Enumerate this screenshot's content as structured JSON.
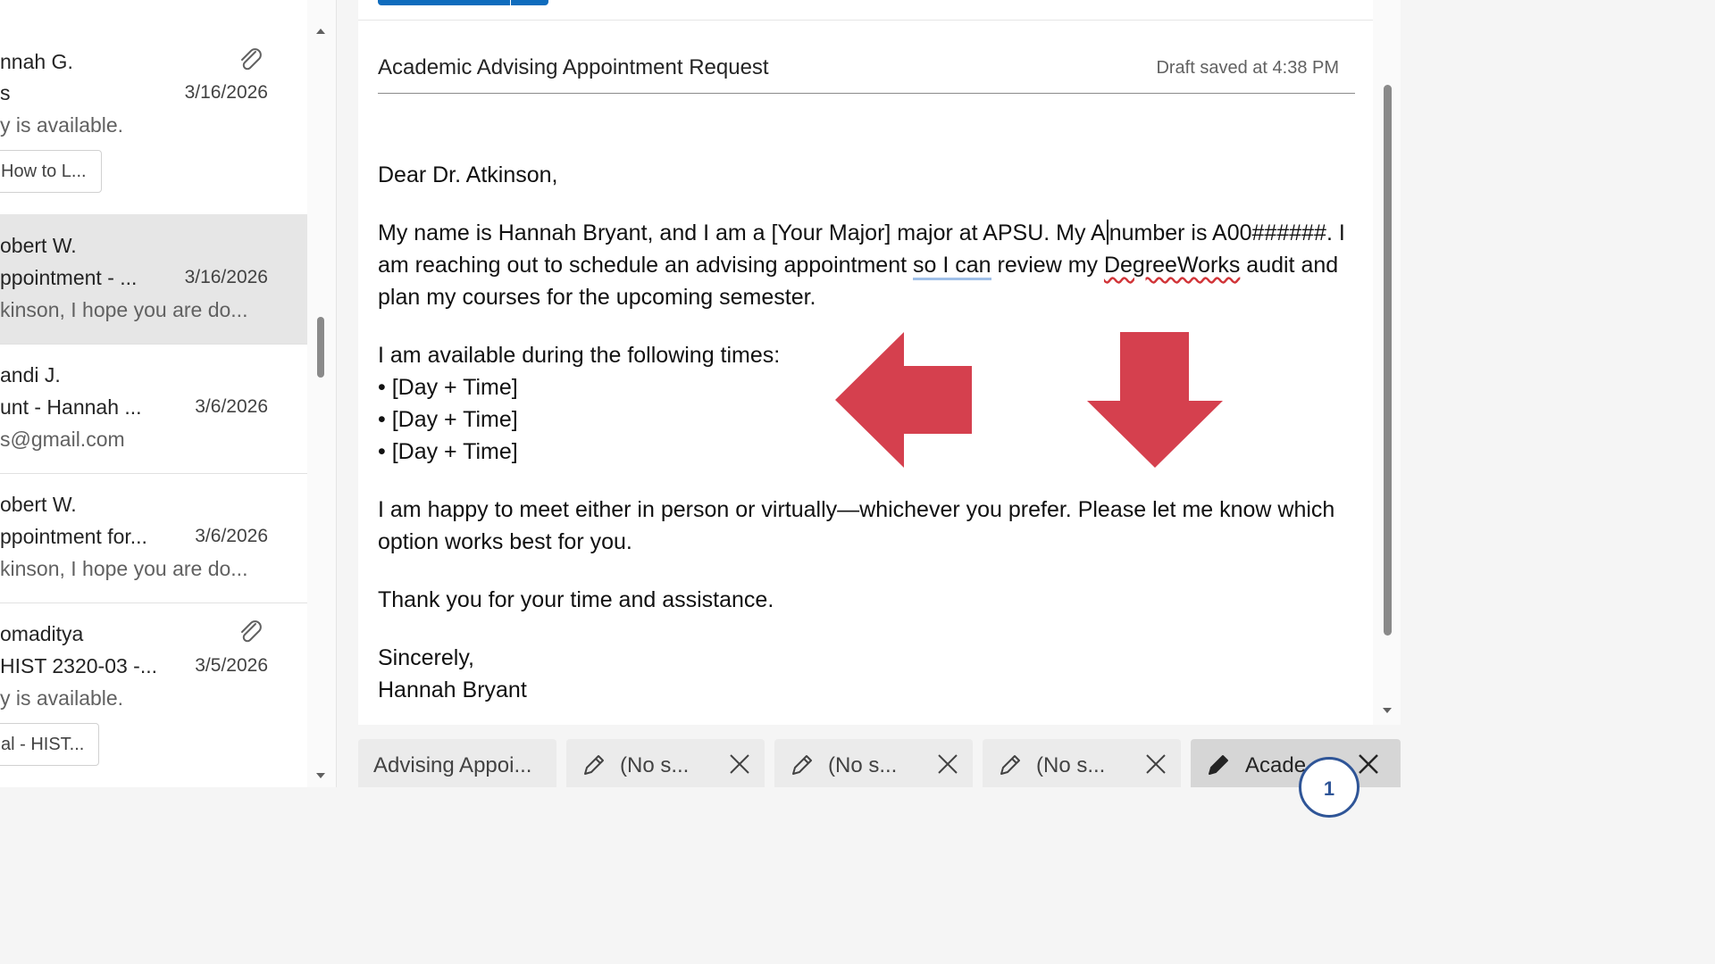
{
  "message_list": {
    "items": [
      {
        "sender": "nnah G.",
        "subject": "s",
        "date": "3/16/2026",
        "preview": "y is available.",
        "attachment_chip": "How to L...",
        "has_attachment": true
      },
      {
        "sender": "obert W.",
        "subject": "ppointment - ...",
        "date": "3/16/2026",
        "preview": "kinson, I hope you are do...",
        "selected": true
      },
      {
        "sender": "andi J.",
        "subject": "unt - Hannah ...",
        "date": "3/6/2026",
        "preview": "s@gmail.com"
      },
      {
        "sender": "obert W.",
        "subject": "ppointment for...",
        "date": "3/6/2026",
        "preview": "kinson, I hope you are do..."
      },
      {
        "sender": "omaditya",
        "subject": "HIST 2320-03 -...",
        "date": "3/5/2026",
        "preview": "y is available.",
        "attachment_chip": "al - HIST...",
        "has_attachment": true
      }
    ]
  },
  "compose": {
    "subject": "Academic Advising Appointment Request",
    "draft_status": "Draft saved at 4:38 PM",
    "greeting": "Dear Dr. Atkinson,",
    "para1_a": "My name is Hannah Bryant, and I am a [Your Major] major at APSU. My A",
    "para1_b": "number is A00######. I am reaching out to schedule an advising appointment ",
    "para1_gram": "so I can",
    "para1_c": " review my ",
    "para1_misspelled": "DegreeWorks",
    "para1_d": " audit and plan my courses for the upcoming semester.",
    "availability_intro": "I am available during the following times:",
    "availability_items": [
      "• [Day + Time]",
      "• [Day + Time]",
      "• [Day + Time]"
    ],
    "para3": "I am happy to meet either in person or virtually—whichever you prefer. Please let me know which option works best for you.",
    "para4": "Thank you for your time and assistance.",
    "closing": "Sincerely,",
    "signature": "Hannah Bryant"
  },
  "tabs": [
    {
      "label": "Advising Appoi...",
      "draft": false
    },
    {
      "label": "(No s...",
      "draft": true
    },
    {
      "label": "(No s...",
      "draft": true
    },
    {
      "label": "(No s...",
      "draft": true
    },
    {
      "label": "Acade",
      "draft": true,
      "active": true
    }
  ],
  "badge": {
    "count": "1"
  },
  "colors": {
    "accent": "#0f6cbd",
    "annotation_arrow": "#d5404e",
    "spellcheck": "#d13438"
  }
}
